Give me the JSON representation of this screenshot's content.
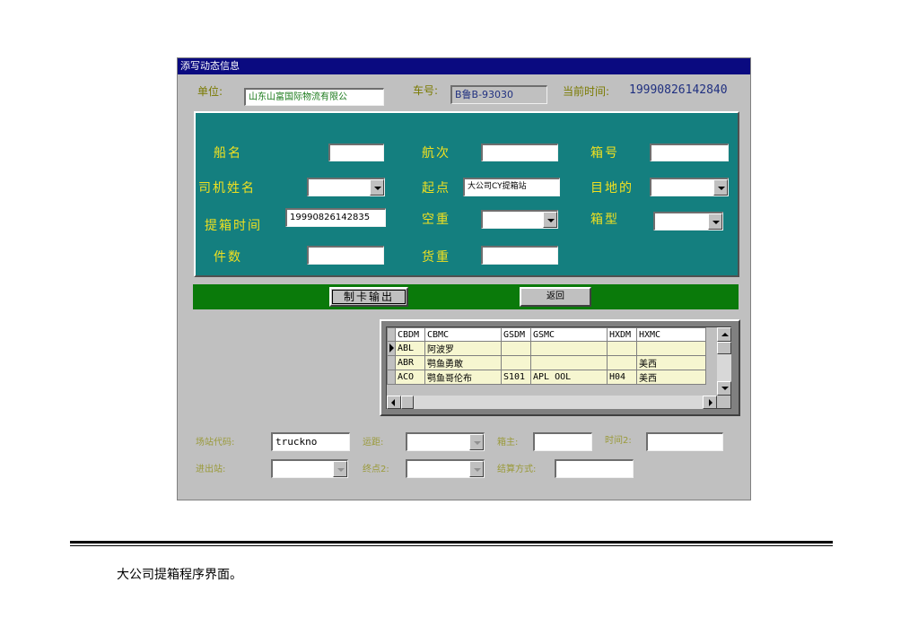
{
  "window": {
    "title": "添写动态信息"
  },
  "header": {
    "unit_label": "单位:",
    "unit_value": "山东山富国际物流有限公",
    "plate_label": "车号:",
    "plate_value": "B鲁B-93030",
    "time_label": "当前时间:",
    "time_value": "19990826142840"
  },
  "form": {
    "ship_name_label": "船名",
    "voyage_label": "航次",
    "box_no_label": "箱号",
    "driver_label": "司机姓名",
    "origin_label": "起点",
    "origin_value": "大公司CY提箱站",
    "destination_label": "目地的",
    "pickup_time_label": "提箱时间",
    "pickup_time_value": "19990826142835",
    "empty_heavy_label": "空重",
    "box_type_label": "箱型",
    "pieces_label": "件数",
    "cargo_weight_label": "货重"
  },
  "actions": {
    "print_card": "制卡输出",
    "back": "返回"
  },
  "grid": {
    "columns": [
      "CBDM",
      "CBMC",
      "GSDM",
      "GSMC",
      "HXDM",
      "HXMC"
    ],
    "rows": [
      [
        "ABL",
        "阿波罗",
        "",
        "",
        "",
        ""
      ],
      [
        "ABR",
        "鹗鱼勇敢",
        "",
        "",
        "",
        "美西"
      ],
      [
        "ACO",
        "鹗鱼哥伦布",
        "S101",
        "APL   OOL",
        "H04",
        "美西"
      ]
    ]
  },
  "bottom": {
    "yard_code_label": "场站代码:",
    "yard_code_value": "truckno",
    "distance_label": "运距:",
    "box_owner_label": "箱主:",
    "time2_label": "时间2:",
    "in_out_label": "进出站:",
    "end2_label": "终点2:",
    "settle_label": "结算方式:"
  },
  "caption": "大公司提箱程序界面。"
}
